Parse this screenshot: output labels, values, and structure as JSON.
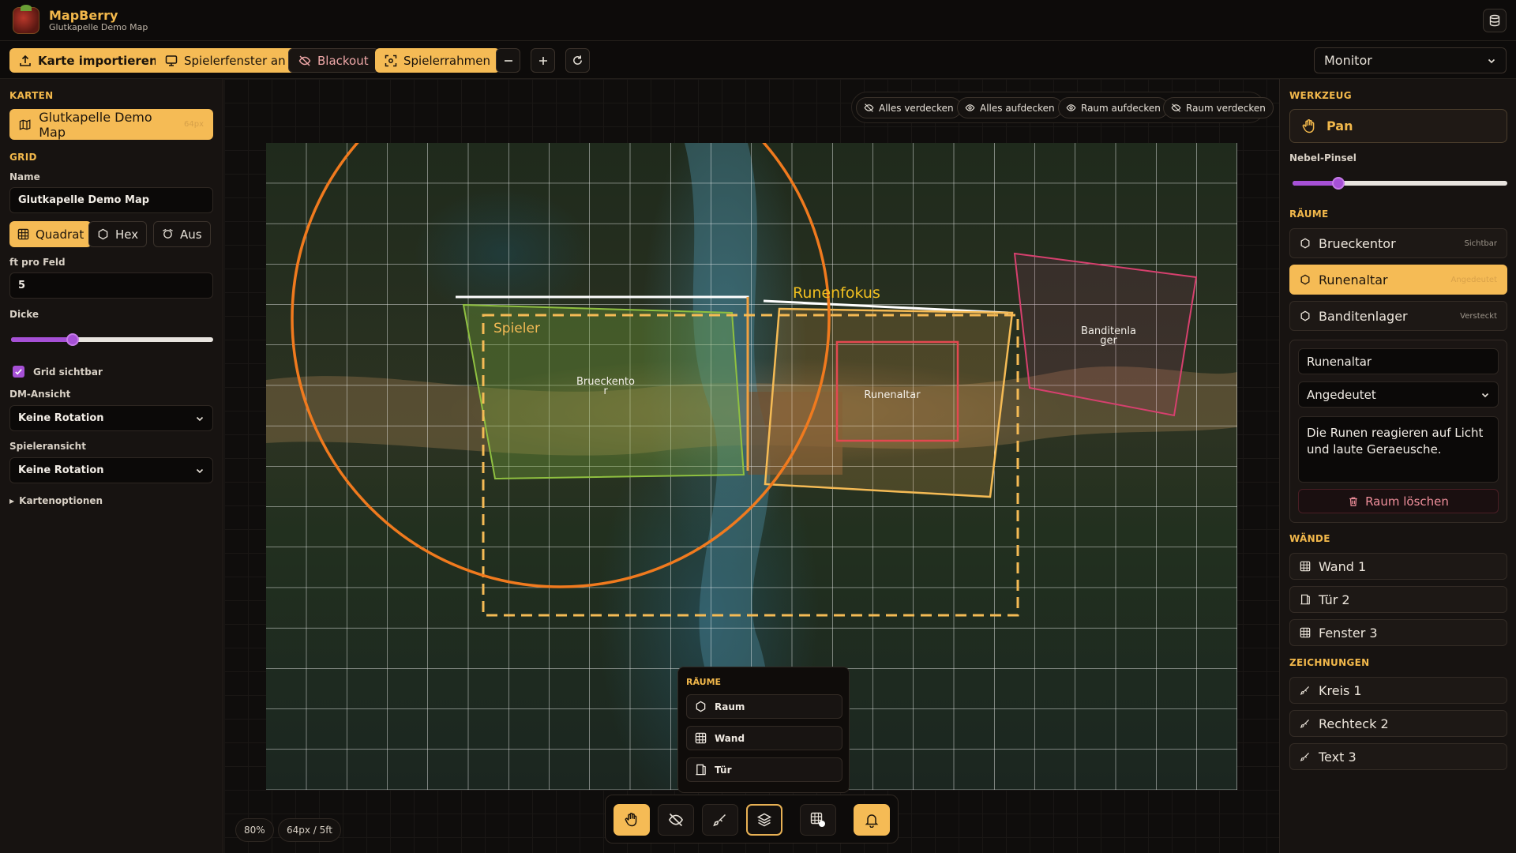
{
  "header": {
    "app_name": "MapBerry",
    "subtitle": "Glutkapelle Demo Map"
  },
  "toolbar": {
    "import_label": "Karte importieren",
    "player_window_label": "Spielerfenster an",
    "blackout_label": "Blackout",
    "player_frame_label": "Spielerrahmen",
    "display_select": "Monitor"
  },
  "left": {
    "maps_title": "KARTEN",
    "map_name": "Glutkapelle Demo Map",
    "map_tag": "64px",
    "grid_title": "GRID",
    "name_label": "Name",
    "name_value": "Glutkapelle Demo Map",
    "grid_types": [
      "Quadrat",
      "Hex",
      "Aus"
    ],
    "ft_label": "ft pro Feld",
    "ft_value": "5",
    "thickness_label": "Dicke",
    "thickness_value": 0.3,
    "grid_visible_label": "Grid sichtbar",
    "grid_visible": true,
    "dm_view_label": "DM-Ansicht",
    "dm_view_value": "Keine Rotation",
    "player_view_label": "Spieleransicht",
    "player_view_value": "Keine Rotation",
    "map_options_label": "Kartenoptionen"
  },
  "fog": {
    "hide_all": "Alles verdecken",
    "reveal_all": "Alles aufdecken",
    "reveal_room": "Raum aufdecken",
    "hide_room": "Raum verdecken"
  },
  "map_labels": {
    "runenfokus": "Runenfokus",
    "spieler": "Spieler",
    "brueckentor": "Brueckento\nr",
    "runenaltar": "Runenaltar",
    "banditenlager": "Banditenla\nger"
  },
  "popup": {
    "title": "RÄUME",
    "items": [
      "Raum",
      "Wand",
      "Tür"
    ]
  },
  "status": {
    "zoom": "80%",
    "scale": "64px / 5ft"
  },
  "right": {
    "tool_title": "WERKZEUG",
    "tool_name": "Pan",
    "brush_label": "Nebel-Pinsel",
    "brush_value": 0.2,
    "rooms_title": "RÄUME",
    "rooms": [
      {
        "name": "Brueckentor",
        "status": "Sichtbar"
      },
      {
        "name": "Runenaltar",
        "status": "Angedeutet"
      },
      {
        "name": "Banditenlager",
        "status": "Versteckt"
      }
    ],
    "edit_name": "Runenaltar",
    "edit_status": "Angedeutet",
    "edit_desc": "Die Runen reagieren auf Licht und laute Geraeusche.",
    "delete_label": "Raum löschen",
    "walls_title": "WÄNDE",
    "walls": [
      "Wand 1",
      "Tür 2",
      "Fenster 3"
    ],
    "drawings_title": "ZEICHNUNGEN",
    "drawings": [
      "Kreis 1",
      "Rechteck 2",
      "Text 3"
    ]
  },
  "colors": {
    "accent": "#f5bb55",
    "purple": "#a650d6",
    "danger": "#f08f9b"
  }
}
